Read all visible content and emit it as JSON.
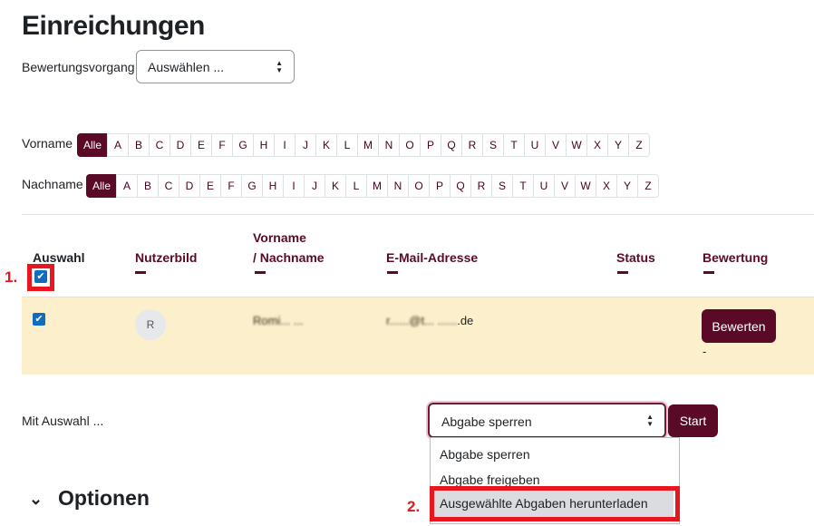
{
  "page": {
    "title": "Einreichungen"
  },
  "grading": {
    "label": "Bewertungsvorgang",
    "select_value": "Auswählen ..."
  },
  "filters": {
    "firstname_label": "Vorname",
    "lastname_label": "Nachname",
    "all_label": "Alle",
    "letters": [
      "A",
      "B",
      "C",
      "D",
      "E",
      "F",
      "G",
      "H",
      "I",
      "J",
      "K",
      "L",
      "M",
      "N",
      "O",
      "P",
      "Q",
      "R",
      "S",
      "T",
      "U",
      "V",
      "W",
      "X",
      "Y",
      "Z"
    ]
  },
  "table": {
    "headers": {
      "select": "Auswahl",
      "picture": "Nutzerbild",
      "name_line1": "Vorname",
      "name_line2": "/ Nachname",
      "email": "E-Mail-Adresse",
      "status": "Status",
      "grade": "Bewertung"
    },
    "row": {
      "avatar_initials": "R",
      "name": "Romi... ...",
      "email_prefix": "r......@t... ......",
      "email_suffix": ".de",
      "grade_button": "Bewerten",
      "grade_value": "-"
    }
  },
  "bulk": {
    "label": "Mit Auswahl ...",
    "select_value": "Abgabe sperren",
    "start_label": "Start",
    "options": [
      "Abgabe sperren",
      "Abgabe freigeben",
      "Ausgewählte Abgaben herunterladen"
    ]
  },
  "annotations": {
    "step1": "1.",
    "step2": "2."
  },
  "options_section": {
    "title": "Optionen"
  },
  "colors": {
    "brand": "#5a0a26",
    "highlight_row": "#fcefcb",
    "annotation_red": "#e8161e",
    "checkbox_blue": "#0f6cbf"
  }
}
